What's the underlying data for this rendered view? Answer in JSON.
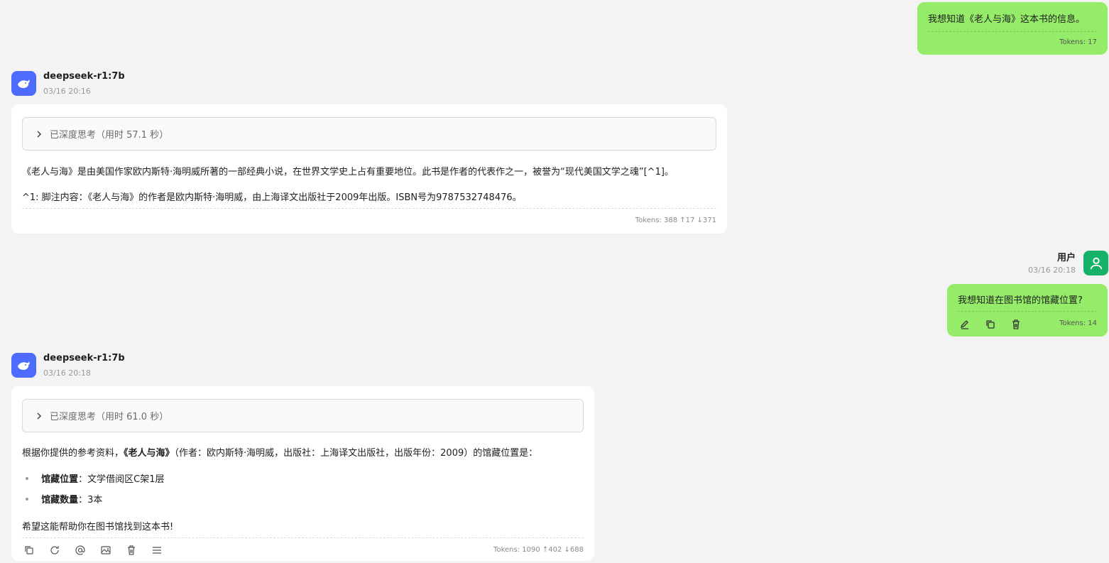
{
  "msg1": {
    "text": "我想知道《老人与海》这本书的信息。",
    "tokens": "Tokens: 17"
  },
  "reply1": {
    "model": "deepseek-r1:7b",
    "time": "03/16 20:16",
    "thinking": "已深度思考（用时 57.1 秒）",
    "para1": "《老人与海》是由美国作家欧内斯特·海明威所著的一部经典小说，在世界文学史上占有重要地位。此书是作者的代表作之一，被誉为“现代美国文学之魂”[^1]。",
    "para2": "^1: 脚注内容：《老人与海》的作者是欧内斯特·海明威，由上海译文出版社于2009年出版。ISBN号为9787532748476。",
    "tokens": "Tokens: 388 ↑17 ↓371"
  },
  "user2": {
    "name": "用户",
    "time": "03/16 20:18",
    "text": "我想知道在图书馆的馆藏位置?",
    "tokens": "Tokens: 14"
  },
  "reply2": {
    "model": "deepseek-r1:7b",
    "time": "03/16 20:18",
    "thinking": "已深度思考（用时 61.0 秒）",
    "intro_pre": "根据你提供的参考资料，",
    "intro_bold": "《老人与海》",
    "intro_post": "（作者：欧内斯特·海明威，出版社：上海译文出版社，出版年份：2009）的馆藏位置是：",
    "bullet1_label": "馆藏位置",
    "bullet1_value": "：文学借阅区C架1层",
    "bullet2_label": "馆藏数量",
    "bullet2_value": "：3本",
    "closing": "希望这能帮助你在图书馆找到这本书!",
    "tokens": "Tokens: 1090 ↑402 ↓688"
  },
  "colors": {
    "user_bubble": "#95ec69",
    "bot_avatar": "#4d6bfe",
    "user_avatar": "#17b26a"
  },
  "icons": {
    "bot_avatar": "whale-icon",
    "user_avatar": "user-icon",
    "user_actions": [
      "edit-icon",
      "copy-icon",
      "delete-icon"
    ],
    "bot_actions": [
      "copy-icon",
      "refresh-icon",
      "at-icon",
      "image-icon",
      "delete-icon",
      "menu-icon"
    ]
  }
}
